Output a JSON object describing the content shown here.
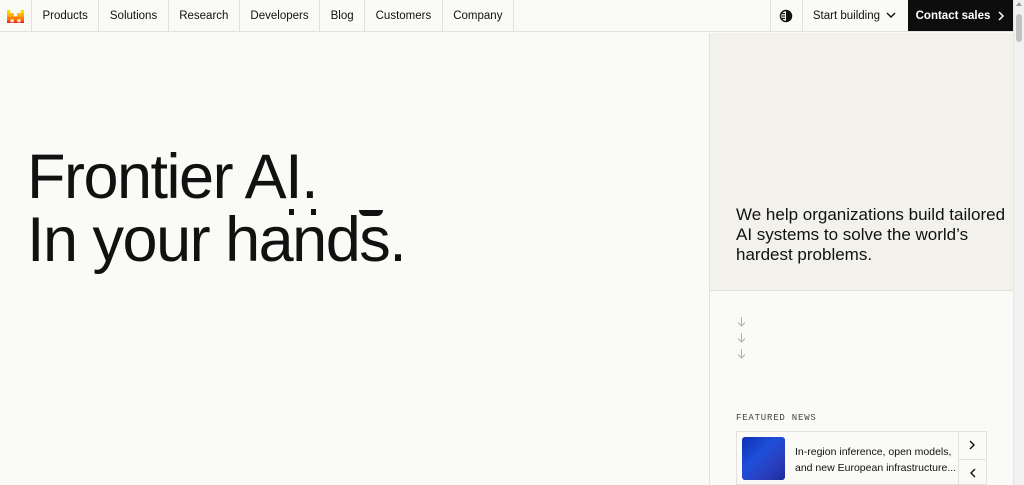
{
  "nav": {
    "items": [
      {
        "label": "Products",
        "name": "nav-products"
      },
      {
        "label": "Solutions",
        "name": "nav-solutions"
      },
      {
        "label": "Research",
        "name": "nav-research"
      },
      {
        "label": "Developers",
        "name": "nav-developers"
      },
      {
        "label": "Blog",
        "name": "nav-blog"
      },
      {
        "label": "Customers",
        "name": "nav-customers"
      },
      {
        "label": "Company",
        "name": "nav-company"
      }
    ],
    "start_building": "Start building",
    "contact_sales": "Contact sales"
  },
  "hero": {
    "line1": "Frontier AI.",
    "line2": "In your hands."
  },
  "panel": {
    "tagline": "We help organizations build tailored AI systems to solve the world’s hardest problems."
  },
  "featured": {
    "label": "FEATURED NEWS",
    "line1": "In-region inference, open models,",
    "line2": "and new European infrastructure..."
  },
  "colors": {
    "logo_orange": "#f5610a",
    "logo_yellow": "#ffb000",
    "logo_red": "#e10500",
    "dark": "#0d0d0d",
    "news_thumb_blue": "#1e4fd8"
  },
  "icons": {
    "logo": "brand-logo-icon",
    "theme": "theme-toggle-icon",
    "start_chevron": "chevron-down-icon",
    "contact_chevron": "chevron-right-icon",
    "scroll_arrows": "arrow-down-icon",
    "news_next": "chevron-right-icon",
    "news_prev": "chevron-left-icon"
  }
}
